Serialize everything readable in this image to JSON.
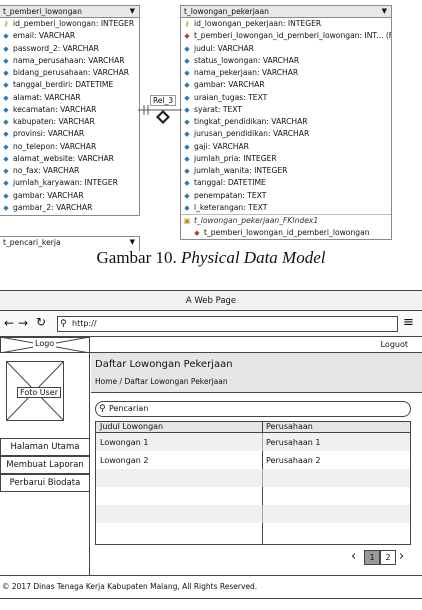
{
  "erd": {
    "left_table": {
      "name": "t_pemberi_lowongan",
      "columns": [
        {
          "icon": "key-icon",
          "text": "id_pemberi_lowongan: INTEGER"
        },
        {
          "icon": "diamond-icon",
          "text": "email: VARCHAR"
        },
        {
          "icon": "diamond-icon",
          "text": "password_2: VARCHAR"
        },
        {
          "icon": "diamond-icon",
          "text": "nama_perusahaan: VARCHAR"
        },
        {
          "icon": "diamond-icon",
          "text": "bidang_perusahaan: VARCHAR"
        },
        {
          "icon": "diamond-icon",
          "text": "tanggal_berdiri: DATETIME"
        },
        {
          "icon": "diamond-icon",
          "text": "alamat: VARCHAR"
        },
        {
          "icon": "diamond-icon",
          "text": "kecamatan: VARCHAR"
        },
        {
          "icon": "diamond-icon",
          "text": "kabupaten: VARCHAR"
        },
        {
          "icon": "diamond-icon",
          "text": "provinsi: VARCHAR"
        },
        {
          "icon": "diamond-icon",
          "text": "no_telepon: VARCHAR"
        },
        {
          "icon": "diamond-icon",
          "text": "alamat_website: VARCHAR"
        },
        {
          "icon": "diamond-icon",
          "text": "no_fax: VARCHAR"
        },
        {
          "icon": "diamond-icon",
          "text": "jumlah_karyawan: INTEGER"
        },
        {
          "icon": "diamond-icon",
          "text": "gambar: VARCHAR"
        },
        {
          "icon": "diamond-icon",
          "text": "gambar_2: VARCHAR"
        }
      ]
    },
    "right_table": {
      "name": "t_lowongan_pekerjaan",
      "columns": [
        {
          "icon": "key-icon",
          "text": "id_lowongan_pekerjaan: INTEGER"
        },
        {
          "icon": "fk-icon",
          "text": "t_pemberi_lowongan_id_pemberi_lowongan: INT... (FK)"
        },
        {
          "icon": "diamond-icon",
          "text": "judul: VARCHAR"
        },
        {
          "icon": "diamond-icon",
          "text": "status_lowongan: VARCHAR"
        },
        {
          "icon": "diamond-icon",
          "text": "nama_pekerjaan: VARCHAR"
        },
        {
          "icon": "diamond-icon",
          "text": "gambar: VARCHAR"
        },
        {
          "icon": "diamond-icon",
          "text": "uraian_tugas: TEXT"
        },
        {
          "icon": "diamond-icon",
          "text": "syarat: TEXT"
        },
        {
          "icon": "diamond-icon",
          "text": "tingkat_pendidikan: VARCHAR"
        },
        {
          "icon": "diamond-icon",
          "text": "jurusan_pendidikan: VARCHAR"
        },
        {
          "icon": "diamond-icon",
          "text": "gaji: VARCHAR"
        },
        {
          "icon": "diamond-icon",
          "text": "jumlah_pria: INTEGER"
        },
        {
          "icon": "diamond-icon",
          "text": "jumlah_wanita: INTEGER"
        },
        {
          "icon": "diamond-icon",
          "text": "tanggal: DATETIME"
        },
        {
          "icon": "diamond-icon",
          "text": "penempatan: TEXT"
        },
        {
          "icon": "diamond-icon",
          "text": "l_keterangan: TEXT"
        }
      ],
      "index_name": "t_lowongan_pekerjaan_FKIndex1",
      "index_column": "t_pemberi_lowongan_id_pemberi_lowongan"
    },
    "relation_label": "Rel_3",
    "bottom_table": {
      "name": "t_pencari_kerja"
    }
  },
  "caption": {
    "prefix": "Gambar 10. ",
    "title": "Physical Data Model"
  },
  "mockup": {
    "window_title": "A Web Page",
    "url": "http://",
    "logo": "Logo",
    "logout": "Loguot",
    "photo": "Foto User",
    "nav": [
      "Halaman Utama",
      "Membuat Laporan",
      "Perbarui Biodata"
    ],
    "page_title": "Daftar Lowongan Pekerjaan",
    "breadcrumb": "Home / Daftar Lowongan Pekerjaan",
    "search_placeholder": "Pencarian",
    "table_headers": [
      "Judul Lowongan",
      "Perusahaan"
    ],
    "rows": [
      [
        "Lowongan 1",
        "Perusahaan 1"
      ],
      [
        "Lowongan 2",
        "Perusahaan 2"
      ]
    ],
    "pages": [
      "1",
      "2"
    ],
    "footer": "© 2017 Dinas Tenaga Kerja Kabupaten Malang, All Rights Reserved."
  }
}
